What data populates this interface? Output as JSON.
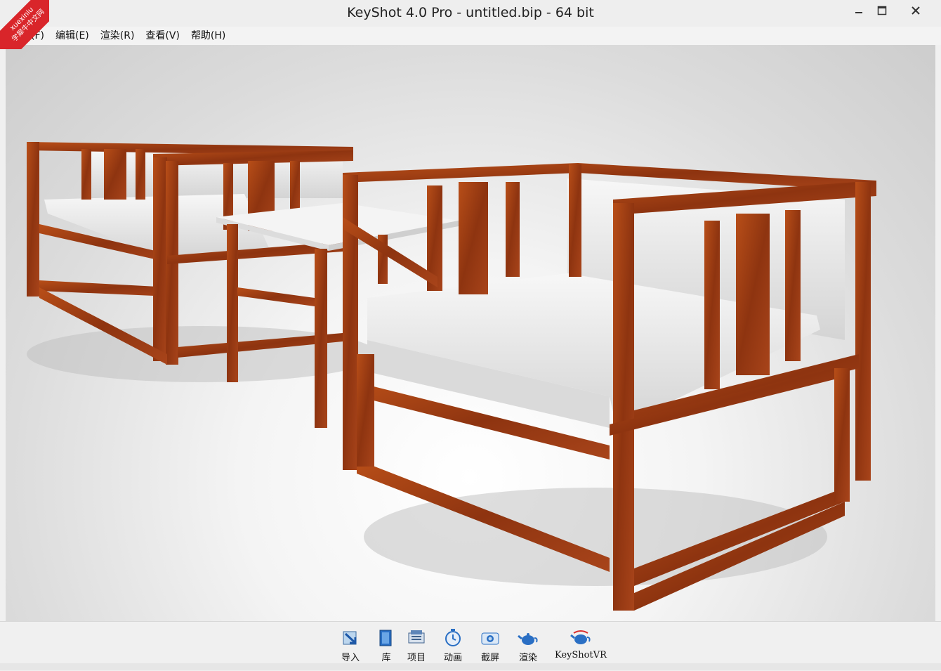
{
  "window": {
    "title": "KeyShot 4.0 Pro  - untitled.bip  - 64 bit"
  },
  "watermark": {
    "line1": "xuexiniu",
    "line2": "学犀牛中文网"
  },
  "menu": [
    {
      "label": "文件(F)"
    },
    {
      "label": "编辑(E)"
    },
    {
      "label": "渲染(R)"
    },
    {
      "label": "查看(V)"
    },
    {
      "label": "帮助(H)"
    }
  ],
  "toolbar": [
    {
      "label": "导入",
      "icon": "import-icon"
    },
    {
      "label": "库",
      "icon": "library-icon"
    },
    {
      "label": "项目",
      "icon": "project-icon"
    },
    {
      "label": "动画",
      "icon": "animation-icon"
    },
    {
      "label": "截屏",
      "icon": "screenshot-icon"
    },
    {
      "label": "渲染",
      "icon": "render-teapot-icon"
    },
    {
      "label": "KeyShotVR",
      "icon": "keyshotvr-icon"
    }
  ],
  "colors": {
    "wood": "#9a3a10",
    "wood_light": "#c0561c",
    "cushion": "#eeeeee",
    "background": "#d8d8d8"
  }
}
